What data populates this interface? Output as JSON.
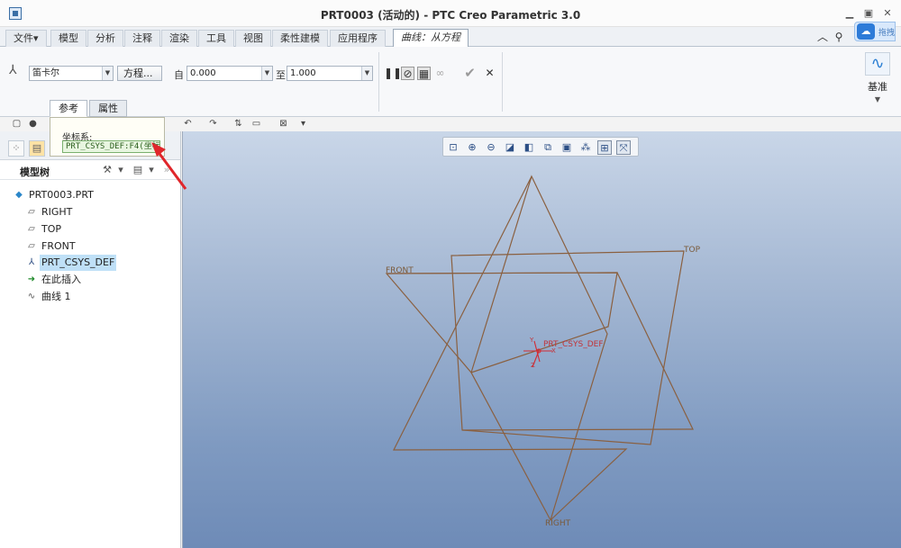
{
  "window": {
    "title": "PRT0003 (活动的) - PTC Creo Parametric 3.0"
  },
  "menu_tabs": [
    "文件",
    "模型",
    "分析",
    "注释",
    "渲染",
    "工具",
    "视图",
    "柔性建模",
    "应用程序"
  ],
  "file_arrow": "▾",
  "active_tab": "曲线：从方程",
  "cloud_badge": "拖拽",
  "ribbon": {
    "coord_type": "笛卡尔",
    "equation_button": "方程...",
    "from_label": "自",
    "from_value": "0.000",
    "to_label": "至",
    "to_value": "1.000",
    "datum_label": "基准"
  },
  "panel_tabs": {
    "reference": "参考",
    "properties": "属性"
  },
  "ref_popup": {
    "label": "坐标系:",
    "value": "PRT_CSYS_DEF:F4(坐标系)"
  },
  "model_tree": {
    "title": "模型树",
    "items": [
      {
        "label": "PRT0003.PRT",
        "icon": "part-icon"
      },
      {
        "label": "RIGHT",
        "icon": "datum-plane-icon"
      },
      {
        "label": "TOP",
        "icon": "datum-plane-icon"
      },
      {
        "label": "FRONT",
        "icon": "datum-plane-icon"
      },
      {
        "label": "PRT_CSYS_DEF",
        "icon": "csys-icon"
      },
      {
        "label": "在此插入",
        "icon": "insert-arrow-icon"
      },
      {
        "label": "曲线 1",
        "icon": "curve-icon"
      }
    ]
  },
  "graphics": {
    "plane_labels": {
      "top": "TOP",
      "front": "FRONT",
      "right": "RIGHT"
    },
    "csys_label": "PRT_CSYS_DEF",
    "axis_labels": {
      "x": "X",
      "y": "Y",
      "z": "Z"
    }
  },
  "colors": {
    "curve": "#8a6040",
    "csys": "#d42a32",
    "selected": "#bfe0f7"
  }
}
